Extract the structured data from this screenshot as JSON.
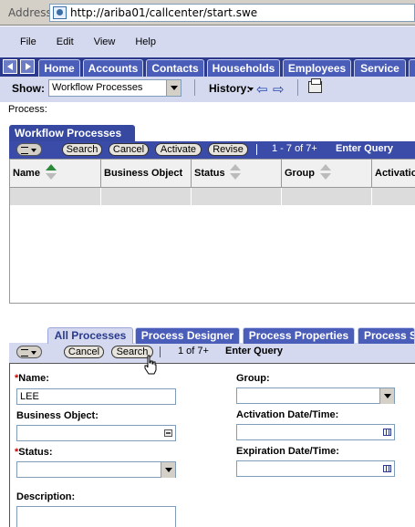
{
  "address": {
    "label": "Address",
    "url": "http://ariba01/callcenter/start.swe"
  },
  "menu": [
    "File",
    "Edit",
    "View",
    "Help"
  ],
  "screen_tabs": [
    "Home",
    "Accounts",
    "Contacts",
    "Households",
    "Employees",
    "Service"
  ],
  "showbar": {
    "show_label": "Show:",
    "show_value": "Workflow Processes",
    "history_label": "History:"
  },
  "process_label": "Process:",
  "list_applet": {
    "title": "Workflow Processes",
    "buttons": [
      "Search",
      "Cancel",
      "Activate",
      "Revise"
    ],
    "record_count": "1 - 7 of 7+",
    "mode": "Enter Query",
    "columns": [
      "Name",
      "Business Object",
      "Status",
      "Group",
      "Activatio"
    ]
  },
  "view_tabs": [
    "All Processes",
    "Process Designer",
    "Process Properties",
    "Process S"
  ],
  "form_applet": {
    "buttons": [
      "Cancel",
      "Search"
    ],
    "record_count": "1 of 7+",
    "mode": "Enter Query",
    "fields": {
      "name_label": "Name:",
      "name_value": "LEE",
      "business_object_label": "Business Object:",
      "status_label": "Status:",
      "description_label": "Description:",
      "group_label": "Group:",
      "activation_label": "Activation Date/Time:",
      "expiration_label": "Expiration Date/Time:"
    },
    "required_mark": "*"
  }
}
